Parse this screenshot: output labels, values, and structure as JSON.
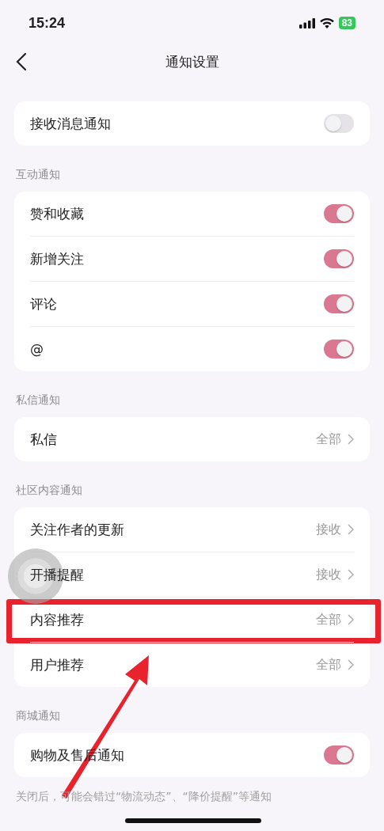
{
  "status_bar": {
    "time": "15:24",
    "battery": "83"
  },
  "nav": {
    "title": "通知设置"
  },
  "sections": [
    {
      "rows": [
        {
          "kind": "toggle",
          "label": "接收消息通知",
          "on": false,
          "highlighted": false
        }
      ]
    },
    {
      "header": "互动通知",
      "rows": [
        {
          "kind": "toggle",
          "label": "赞和收藏",
          "on": true,
          "highlighted": false
        },
        {
          "kind": "toggle",
          "label": "新增关注",
          "on": true,
          "highlighted": false
        },
        {
          "kind": "toggle",
          "label": "评论",
          "on": true,
          "highlighted": false
        },
        {
          "kind": "toggle",
          "label": "@",
          "on": true,
          "highlighted": false
        }
      ]
    },
    {
      "header": "私信通知",
      "rows": [
        {
          "kind": "link",
          "label": "私信",
          "value": "全部",
          "highlighted": false
        }
      ]
    },
    {
      "header": "社区内容通知",
      "rows": [
        {
          "kind": "link",
          "label": "关注作者的更新",
          "value": "接收",
          "highlighted": false
        },
        {
          "kind": "link",
          "label": "开播提醒",
          "value": "接收",
          "highlighted": false
        },
        {
          "kind": "link",
          "label": "内容推荐",
          "value": "全部",
          "highlighted": true
        },
        {
          "kind": "link",
          "label": "用户推荐",
          "value": "全部",
          "highlighted": false
        }
      ]
    },
    {
      "header": "商城通知",
      "rows": [
        {
          "kind": "toggle",
          "label": "购物及售后通知",
          "on": true,
          "highlighted": false
        }
      ],
      "footer": "关闭后，可能会错过“物流动态”、“降价提醒”等通知"
    }
  ]
}
